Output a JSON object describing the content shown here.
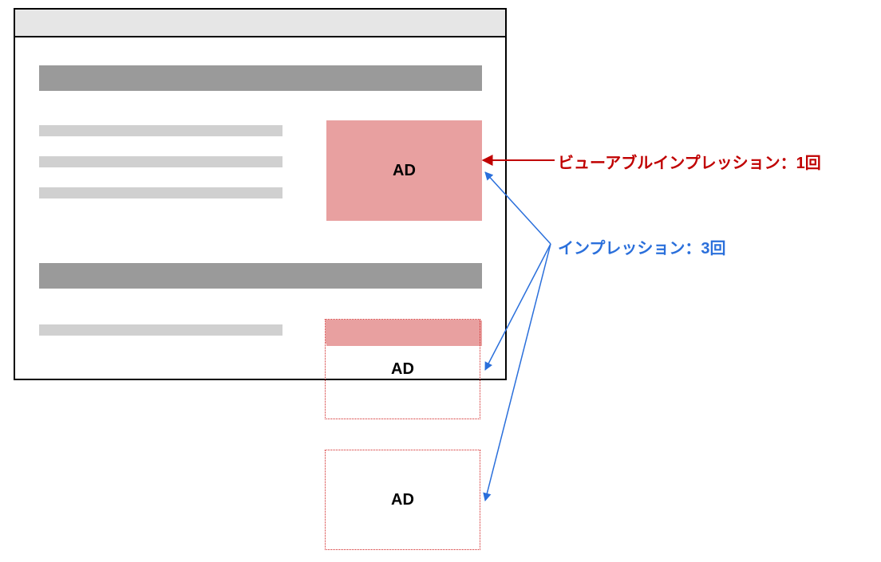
{
  "ads": {
    "ad1_label": "AD",
    "ad2_label": "AD",
    "ad3_label": "AD"
  },
  "annotations": {
    "viewable_impression": "ビューアブルインプレッション：1回",
    "impression": "インプレッション：3回"
  },
  "colors": {
    "viewable_arrow": "#c00000",
    "impression_arrow": "#2a6fdb",
    "ad_fill": "#e8a0a0",
    "ad_border": "#d02020",
    "content_bar": "#9a9a9a",
    "text_line": "#d0d0d0"
  }
}
